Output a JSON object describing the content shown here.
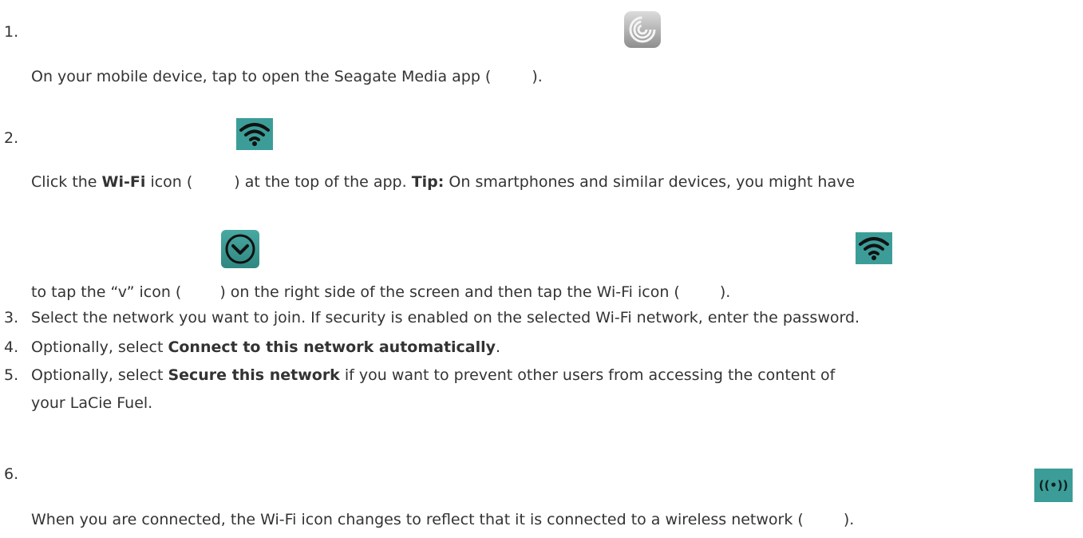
{
  "steps": [
    {
      "num": "1.",
      "text_a": "On your mobile device, tap to open the Seagate Media app (",
      "text_b": ")."
    },
    {
      "num": "2.",
      "line1_a": "Click the ",
      "line1_b": "Wi-Fi",
      "line1_c": " icon (",
      "line1_d": ") at the top of the app. ",
      "line1_e": "Tip:",
      "line1_f": " On smartphones and similar devices, you might have",
      "line2_a": "to tap the “v” icon (",
      "line2_b": ") on the right side of the screen and then tap the Wi-Fi icon (",
      "line2_c": ")."
    },
    {
      "num": "3.",
      "text": "Select the network you want to join. If security is enabled on the selected Wi-Fi network, enter the password."
    },
    {
      "num": "4.",
      "text_a": "Optionally, select ",
      "text_b": "Connect to this network automatically",
      "text_c": "."
    },
    {
      "num": "5.",
      "text_a": "Optionally, select ",
      "text_b": "Secure this network",
      "text_c": " if you want to prevent other users from accessing the content of",
      "line2": "your LaCie Fuel."
    },
    {
      "num": "6.",
      "text_a": "When you are connected, the Wi-Fi icon changes to reflect that it is connected to a wireless network (",
      "text_b": ")."
    }
  ],
  "icons": {
    "app": "seagate-media-app-icon",
    "wifi": "wifi-icon",
    "v": "v-chevron-icon",
    "connected": "wifi-connected-icon",
    "connected_glyph": "((•))"
  },
  "colors": {
    "text": "#333333",
    "icon_teal": "#3c9d98"
  }
}
